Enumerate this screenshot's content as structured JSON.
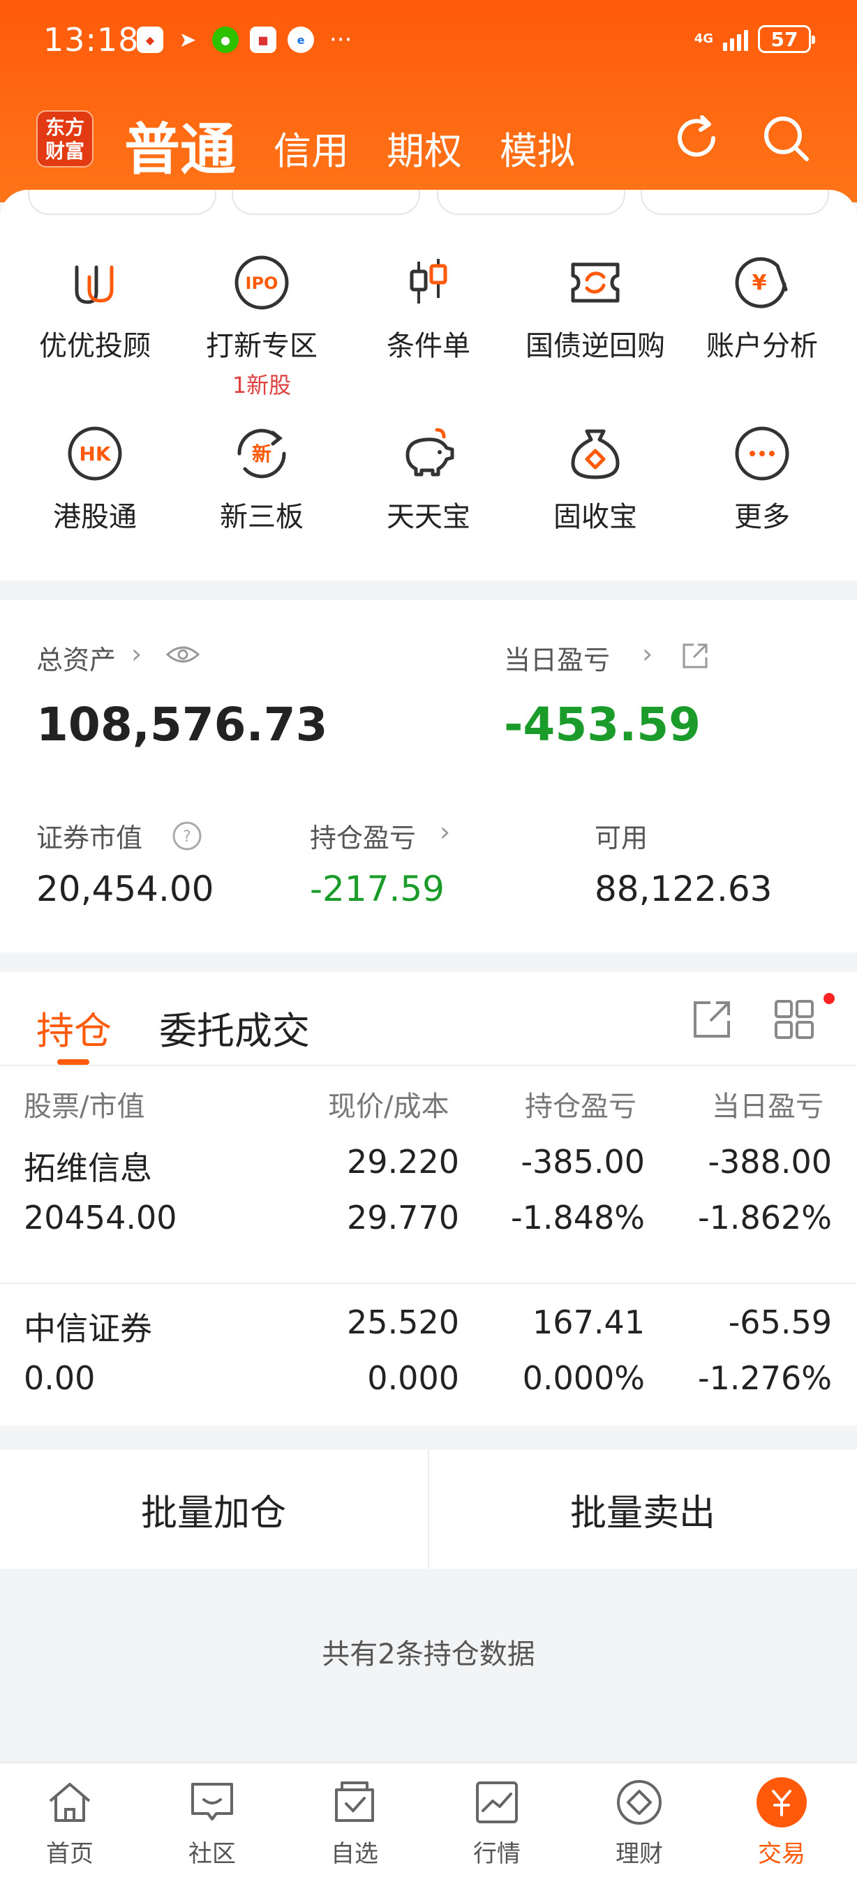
{
  "status_bar": {
    "time": "13:18",
    "network": "4G",
    "battery": "57"
  },
  "header": {
    "logo_text": "东方财富",
    "tabs": [
      {
        "label": "普通",
        "active": true
      },
      {
        "label": "信用",
        "active": false
      },
      {
        "label": "期权",
        "active": false
      },
      {
        "label": "模拟",
        "active": false
      }
    ]
  },
  "feature_grid": {
    "row1": [
      {
        "label": "优优投顾",
        "icon": "uu-advisor-icon"
      },
      {
        "label": "打新专区",
        "icon": "ipo-icon",
        "sub": "1新股"
      },
      {
        "label": "条件单",
        "icon": "condition-order-icon"
      },
      {
        "label": "国债逆回购",
        "icon": "bond-repo-icon"
      },
      {
        "label": "账户分析",
        "icon": "account-analysis-icon"
      }
    ],
    "row2": [
      {
        "label": "港股通",
        "icon": "hk-connect-icon"
      },
      {
        "label": "新三板",
        "icon": "new-third-board-icon"
      },
      {
        "label": "天天宝",
        "icon": "piggy-bank-icon"
      },
      {
        "label": "固收宝",
        "icon": "money-bag-icon"
      },
      {
        "label": "更多",
        "icon": "more-icon"
      }
    ]
  },
  "assets": {
    "total_label": "总资产",
    "total_value": "108,576.73",
    "daily_pl_label": "当日盈亏",
    "daily_pl_value": "-453.59",
    "market_value_label": "证券市值",
    "market_value": "20,454.00",
    "holding_pl_label": "持仓盈亏",
    "holding_pl_value": "-217.59",
    "available_label": "可用",
    "available_value": "88,122.63"
  },
  "positions": {
    "tabs": [
      "持仓",
      "委托成交"
    ],
    "columns": [
      "股票/市值",
      "现价/成本",
      "持仓盈亏",
      "当日盈亏"
    ],
    "rows": [
      {
        "name": "拓维信息",
        "market_value": "20454.00",
        "price": "29.220",
        "cost": "29.770",
        "pl": "-385.00",
        "pl_pct": "-1.848%",
        "day_pl": "-388.00",
        "day_pl_pct": "-1.862%"
      },
      {
        "name": "中信证券",
        "market_value": "0.00",
        "price": "25.520",
        "cost": "0.000",
        "pl": "167.41",
        "pl_pct": "0.000%",
        "day_pl": "-65.59",
        "day_pl_pct": "-1.276%"
      }
    ],
    "batch_add": "批量加仓",
    "batch_sell": "批量卖出",
    "count_text": "共有2条持仓数据"
  },
  "bottom_nav": [
    {
      "label": "首页",
      "icon": "home-icon",
      "active": false
    },
    {
      "label": "社区",
      "icon": "community-icon",
      "active": false
    },
    {
      "label": "自选",
      "icon": "watchlist-icon",
      "active": false
    },
    {
      "label": "行情",
      "icon": "market-icon",
      "active": false
    },
    {
      "label": "理财",
      "icon": "wealth-icon",
      "active": false
    },
    {
      "label": "交易",
      "icon": "trade-icon",
      "active": true
    }
  ],
  "colors": {
    "brand": "#ff5a0a",
    "up": "#e0303a",
    "down": "#1a9b2a"
  }
}
